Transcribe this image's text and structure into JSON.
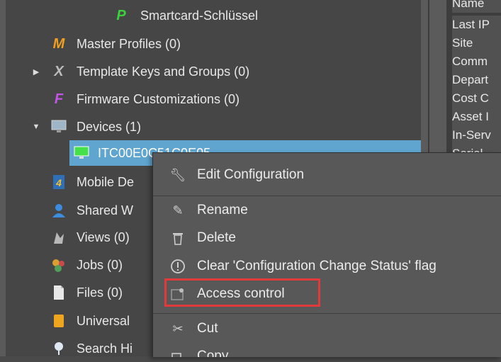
{
  "tree": {
    "items": [
      {
        "label": "Smartcard-Schlüssel",
        "icon": "smartcard-key-icon"
      },
      {
        "label": "Master Profiles (0)",
        "icon": "master-profile-icon"
      },
      {
        "label": "Template Keys and Groups (0)",
        "icon": "template-keys-icon"
      },
      {
        "label": "Firmware Customizations (0)",
        "icon": "firmware-icon"
      },
      {
        "label": "Devices (1)",
        "icon": "monitor-icon"
      },
      {
        "label": "ITC00E0C51C0E05",
        "icon": "device-monitor-icon"
      },
      {
        "label": "Mobile De",
        "icon": "mobile-device-icon"
      },
      {
        "label": "Shared W",
        "icon": "shared-user-icon"
      },
      {
        "label": "Views (0)",
        "icon": "views-icon"
      },
      {
        "label": "Jobs (0)",
        "icon": "jobs-icon"
      },
      {
        "label": "Files (0)",
        "icon": "files-icon"
      },
      {
        "label": "Universal",
        "icon": "universal-icon"
      },
      {
        "label": "Search Hi",
        "icon": "search-history-icon"
      }
    ]
  },
  "properties": {
    "labels": [
      "Name",
      "Last IP",
      "Site",
      "Comm",
      "Depart",
      "Cost C",
      "Asset I",
      "In-Serv",
      "Serial"
    ]
  },
  "context_menu": {
    "items": [
      {
        "label": "Edit Configuration",
        "icon": "wrench-icon"
      },
      {
        "label": "Rename",
        "icon": "pencil-icon"
      },
      {
        "label": "Delete",
        "icon": "trash-icon"
      },
      {
        "label": "Clear 'Configuration Change Status' flag",
        "icon": "exclamation-circle-icon"
      },
      {
        "label": "Access control",
        "icon": "access-control-icon"
      },
      {
        "label": "Cut",
        "icon": "scissors-icon"
      },
      {
        "label": "Copy",
        "icon": "copy-icon"
      }
    ]
  },
  "colors": {
    "selection": "#5fa5cf",
    "highlight_box": "#e2393a",
    "background": "#464646"
  }
}
